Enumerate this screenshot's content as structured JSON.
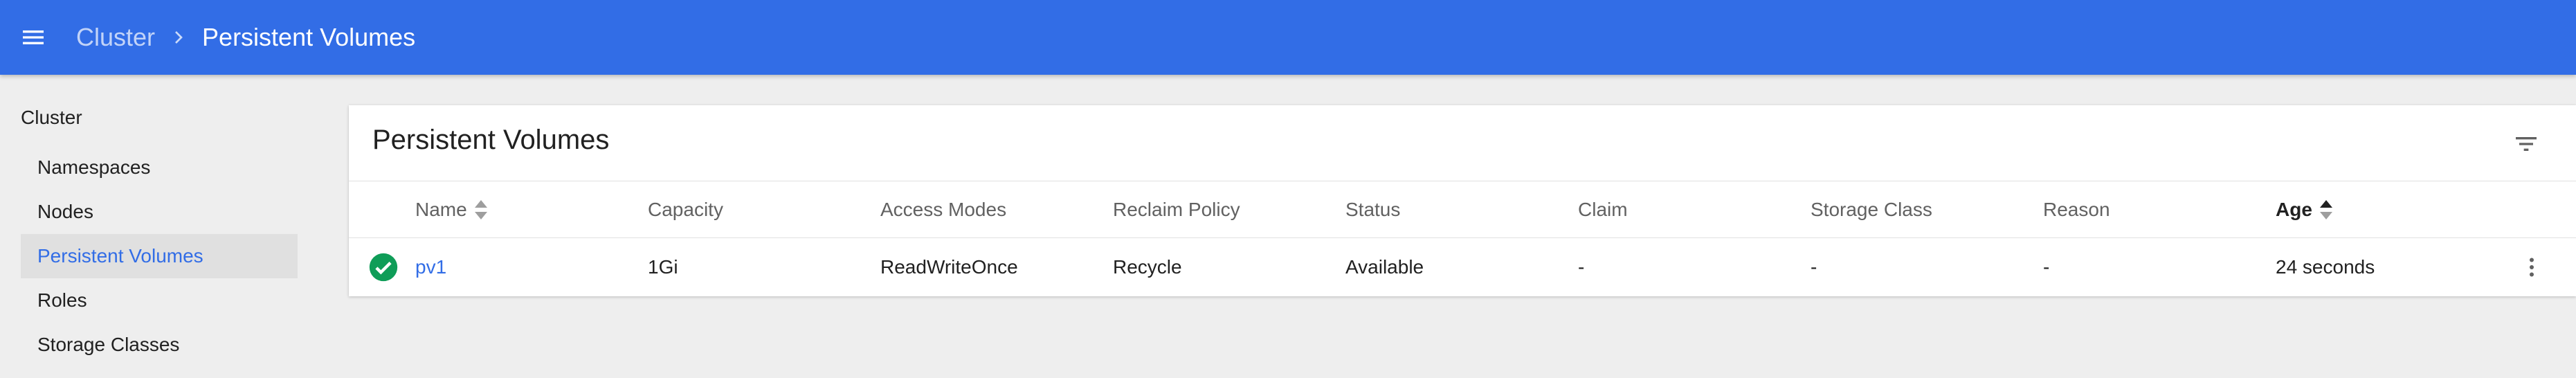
{
  "header": {
    "menu_icon": "hamburger-menu-icon",
    "breadcrumb_parent": "Cluster",
    "breadcrumb_current": "Persistent Volumes",
    "colors": {
      "bar": "#326de6",
      "text": "#ffffff"
    }
  },
  "sidebar": {
    "heading": "Cluster",
    "items": [
      {
        "label": "Namespaces",
        "active": false
      },
      {
        "label": "Nodes",
        "active": false
      },
      {
        "label": "Persistent Volumes",
        "active": true
      },
      {
        "label": "Roles",
        "active": false
      },
      {
        "label": "Storage Classes",
        "active": false
      }
    ]
  },
  "card": {
    "title": "Persistent Volumes",
    "filter_icon": "filter-list-icon",
    "columns": [
      {
        "label": "Name",
        "sortable": true,
        "active": false
      },
      {
        "label": "Capacity",
        "sortable": false
      },
      {
        "label": "Access Modes",
        "sortable": false
      },
      {
        "label": "Reclaim Policy",
        "sortable": false
      },
      {
        "label": "Status",
        "sortable": false
      },
      {
        "label": "Claim",
        "sortable": false
      },
      {
        "label": "Storage Class",
        "sortable": false
      },
      {
        "label": "Reason",
        "sortable": false
      },
      {
        "label": "Age",
        "sortable": true,
        "active": true,
        "direction": "ascending"
      }
    ],
    "rows": [
      {
        "status_icon": "check-circle-icon",
        "status_color": "#0f9d58",
        "cells": [
          "pv1",
          "1Gi",
          "ReadWriteOnce",
          "Recycle",
          "Available",
          "-",
          "-",
          "-",
          "24 seconds"
        ],
        "menu_icon": "more-vert-icon"
      }
    ]
  }
}
